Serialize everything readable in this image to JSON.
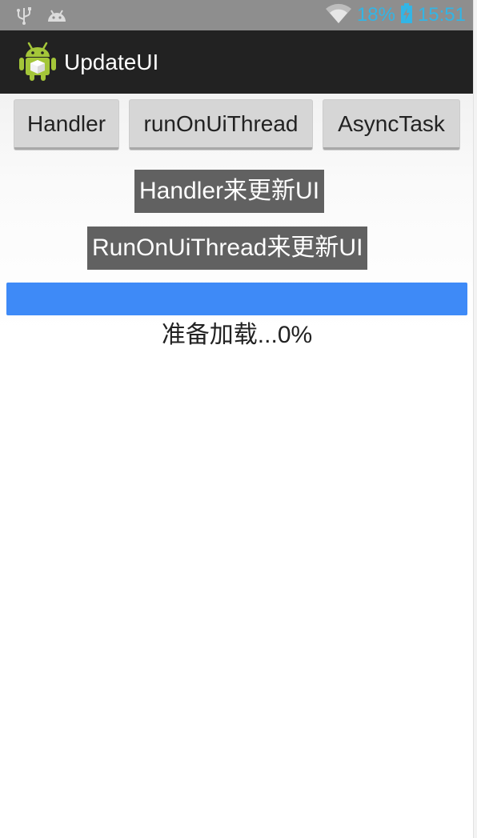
{
  "status_bar": {
    "battery_percent": "18%",
    "time": "15:51",
    "icons": [
      "usb-icon",
      "android-debug-icon",
      "wifi-icon",
      "battery-charging-icon"
    ],
    "accent_color": "#33b5e5"
  },
  "action_bar": {
    "title": "UpdateUI",
    "icon": "android-app-icon"
  },
  "buttons": {
    "handler": "Handler",
    "run_on_ui_thread": "runOnUiThread",
    "async_task": "AsyncTask"
  },
  "labels": {
    "handler_update": "Handler来更新UI",
    "run_on_ui_thread_update": "RunOnUiThread来更新UI"
  },
  "progress": {
    "value_percent": 100,
    "fill_color": "#3e8af7",
    "status_text": "准备加载...0%"
  }
}
